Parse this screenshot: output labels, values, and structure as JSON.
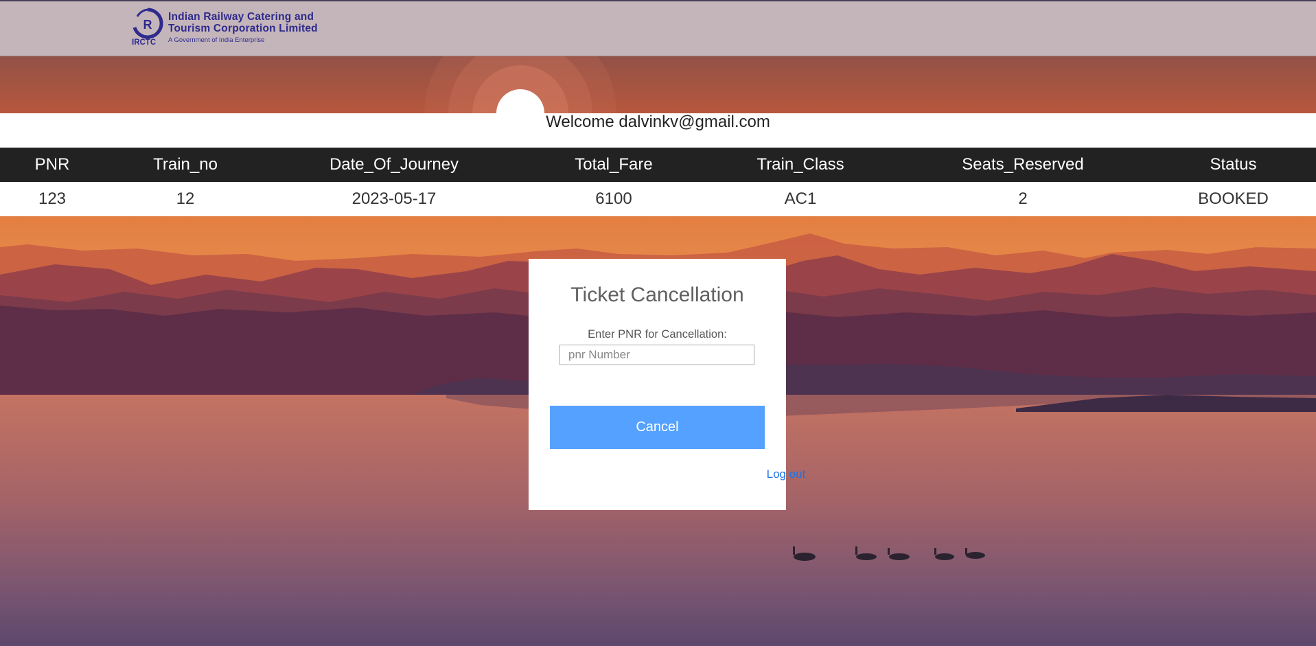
{
  "header": {
    "logo_line1": "Indian Railway Catering and",
    "logo_line2": "Tourism Corporation Limited",
    "logo_line3": "A Government of India Enterprise",
    "logo_abbr": "IRCTC"
  },
  "welcome": {
    "text": "Welcome dalvinkv@gmail.com"
  },
  "table": {
    "columns": [
      "PNR",
      "Train_no",
      "Date_Of_Journey",
      "Total_Fare",
      "Train_Class",
      "Seats_Reserved",
      "Status"
    ],
    "rows": [
      [
        "123",
        "12",
        "2023-05-17",
        "6100",
        "AC1",
        "2",
        "BOOKED"
      ]
    ]
  },
  "cancel_form": {
    "title": "Ticket Cancellation",
    "label": "Enter PNR for Cancellation:",
    "input_placeholder": "pnr Number",
    "input_value": "",
    "button_label": "Cancel",
    "logout_label": "Log out"
  },
  "colors": {
    "header_bg": "#c4b5bb",
    "brand_blue": "#2e2a8c",
    "table_header_bg": "#222222",
    "button_bg": "#55a1ff",
    "link": "#1a73e8"
  }
}
